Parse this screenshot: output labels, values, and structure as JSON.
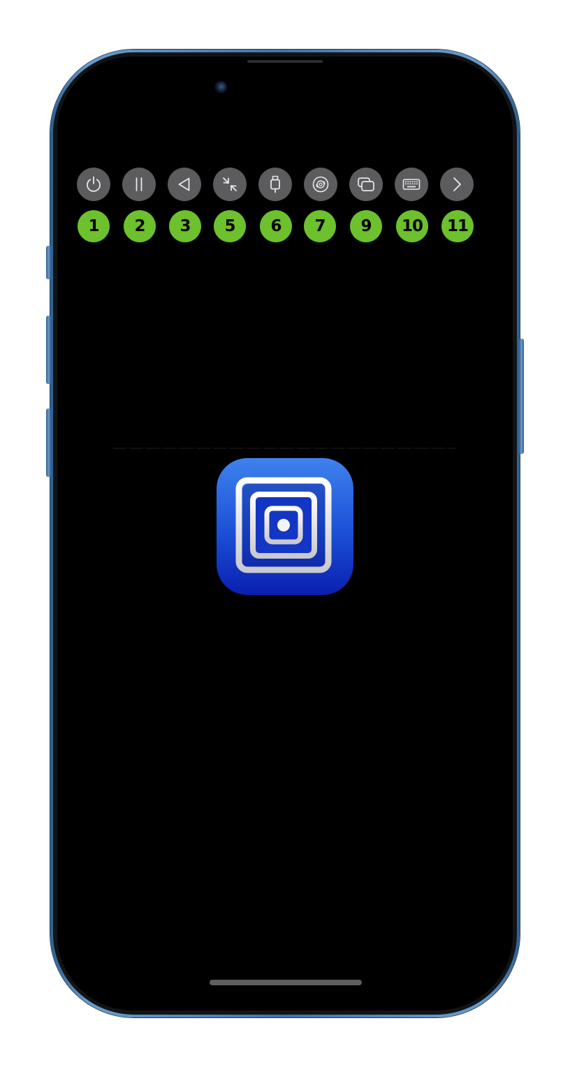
{
  "toolbar": {
    "buttons": [
      {
        "icon": "power-icon",
        "label": "1"
      },
      {
        "icon": "pause-icon",
        "label": "2"
      },
      {
        "icon": "back-triangle-icon",
        "label": "3"
      },
      {
        "icon": "minimize-arrows-icon",
        "label": "5"
      },
      {
        "icon": "usb-drive-icon",
        "label": "6"
      },
      {
        "icon": "disc-icon",
        "label": "7"
      },
      {
        "icon": "windows-stack-icon",
        "label": "9"
      },
      {
        "icon": "keyboard-icon",
        "label": "10"
      },
      {
        "icon": "chevron-right-icon",
        "label": "11"
      }
    ]
  },
  "colors": {
    "button_bg": "#5c5c5e",
    "badge_bg": "#6cc12d",
    "screen_bg": "#000000",
    "frame": "#3f74a8",
    "app_icon_top": "#3f82ee",
    "app_icon_bottom": "#0a1fb0"
  },
  "app_icon": {
    "icon": "utm-app-icon"
  }
}
